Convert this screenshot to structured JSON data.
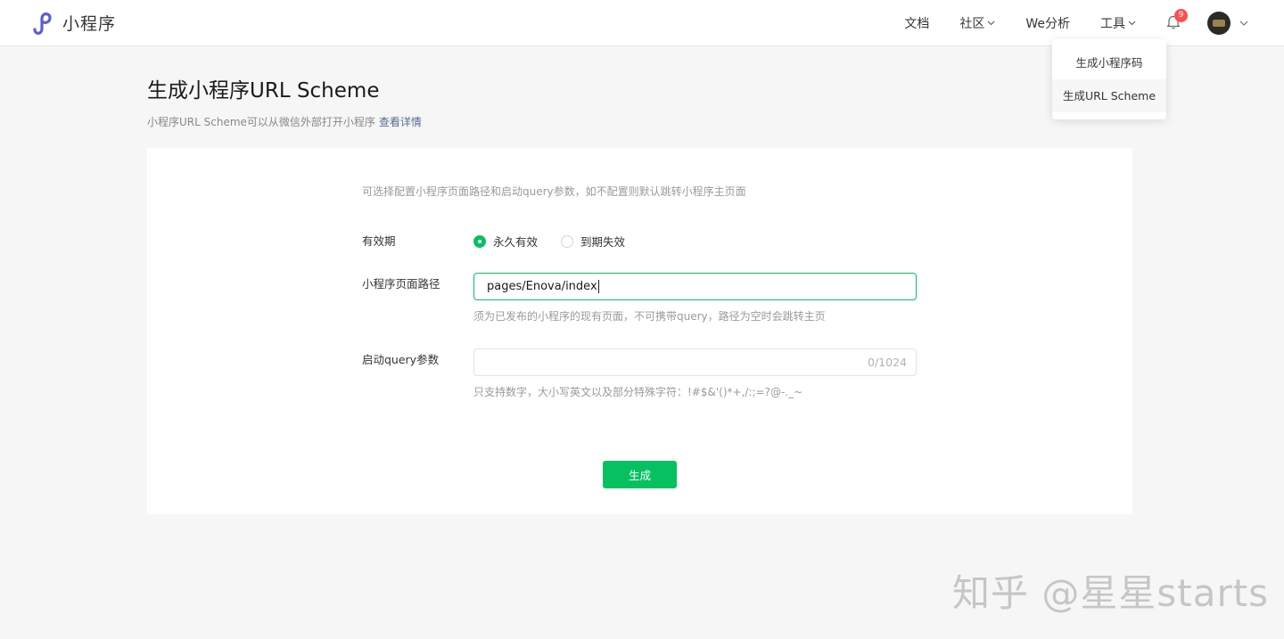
{
  "header": {
    "app_name": "小程序",
    "nav": {
      "docs": "文档",
      "community": "社区",
      "analytics": "We分析",
      "tools": "工具"
    },
    "notification_count": "9"
  },
  "tools_menu": {
    "items": [
      {
        "label": "生成小程序码"
      },
      {
        "label": "生成URL Scheme"
      }
    ],
    "active_index": 1
  },
  "page": {
    "title": "生成小程序URL Scheme",
    "description": "小程序URL Scheme可以从微信外部打开小程序",
    "details_link": "查看详情"
  },
  "form": {
    "tip": "可选择配置小程序页面路径和启动query参数，如不配置则默认跳转小程序主页面",
    "validity": {
      "label": "有效期",
      "options": [
        "永久有效",
        "到期失效"
      ],
      "selected": "永久有效"
    },
    "path": {
      "label": "小程序页面路径",
      "value": "pages/Enova/index",
      "hint": "须为已发布的小程序的现有页面，不可携带query，路径为空时会跳转主页"
    },
    "query": {
      "label": "启动query参数",
      "value": "",
      "counter": "0/1024",
      "hint": "只支持数字，大小写英文以及部分特殊字符：!#$&'()*+,/:;=?@-._~"
    },
    "submit_label": "生成"
  },
  "watermark": "知乎 @星星starts",
  "colors": {
    "brand_green": "#07c160",
    "link_blue": "#576b95",
    "logo_purple": "#5a5ed6",
    "badge_red": "#fa5151"
  }
}
